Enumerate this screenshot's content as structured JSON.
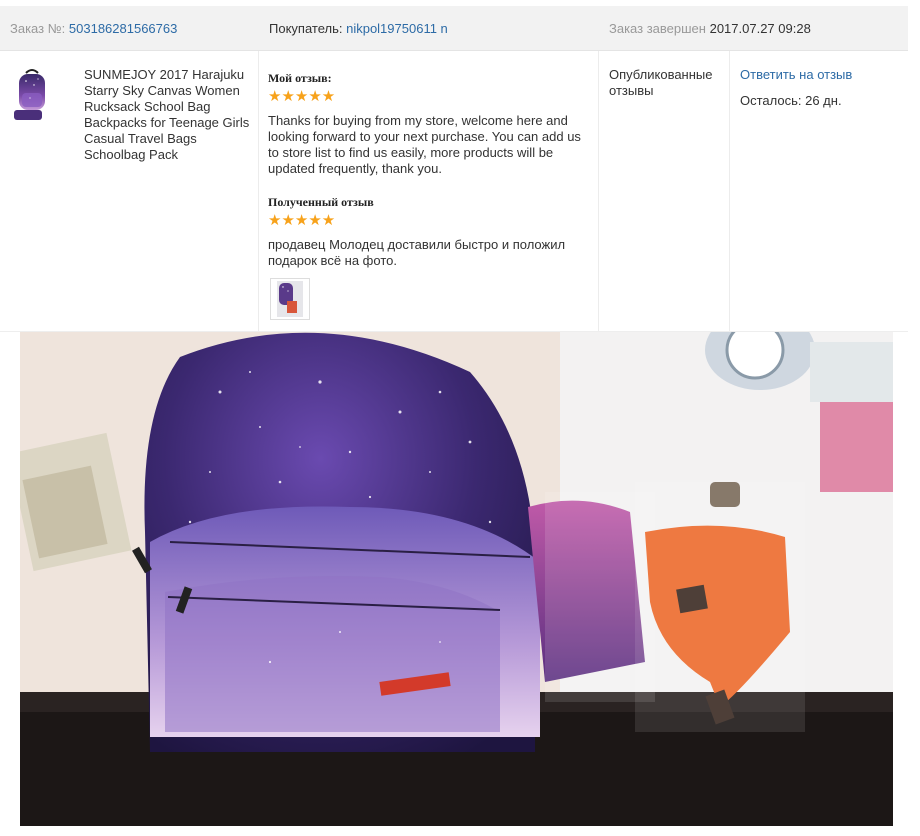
{
  "header": {
    "order_label": "Заказ №:",
    "order_number": "503186281566763",
    "buyer_label": "Покупатель:",
    "buyer_name": "nikpol19750611 n",
    "completed_label": "Заказ завершен",
    "completed_date": "2017.07.27 09:28"
  },
  "product": {
    "title": "SUNMEJOY 2017 Harajuku Starry Sky Canvas Women Rucksack School Bag Backpacks for Teenage Girls Casual Travel Bags Schoolbag Pack"
  },
  "my_review": {
    "heading": "Мой отзыв:",
    "stars": "★★★★★",
    "rating": 5,
    "text": "Thanks for buying from my store, welcome here and looking forward to your next purchase. You can add us to store list to find us easily, more products will be updated frequently, thank you."
  },
  "received_review": {
    "heading": "Полученный отзыв",
    "stars": "★★★★★",
    "rating": 5,
    "text": "продавец Молодец доставили быстро и положил подарок всё на фото."
  },
  "status": {
    "text": "Опубликованные отзывы"
  },
  "actions": {
    "reply_link": "Ответить на отзыв",
    "remaining": "Осталось: 26 дн."
  },
  "colors": {
    "link": "#2d6ba6",
    "stars": "#f7a21b",
    "header_bg": "#f2f2f2"
  }
}
